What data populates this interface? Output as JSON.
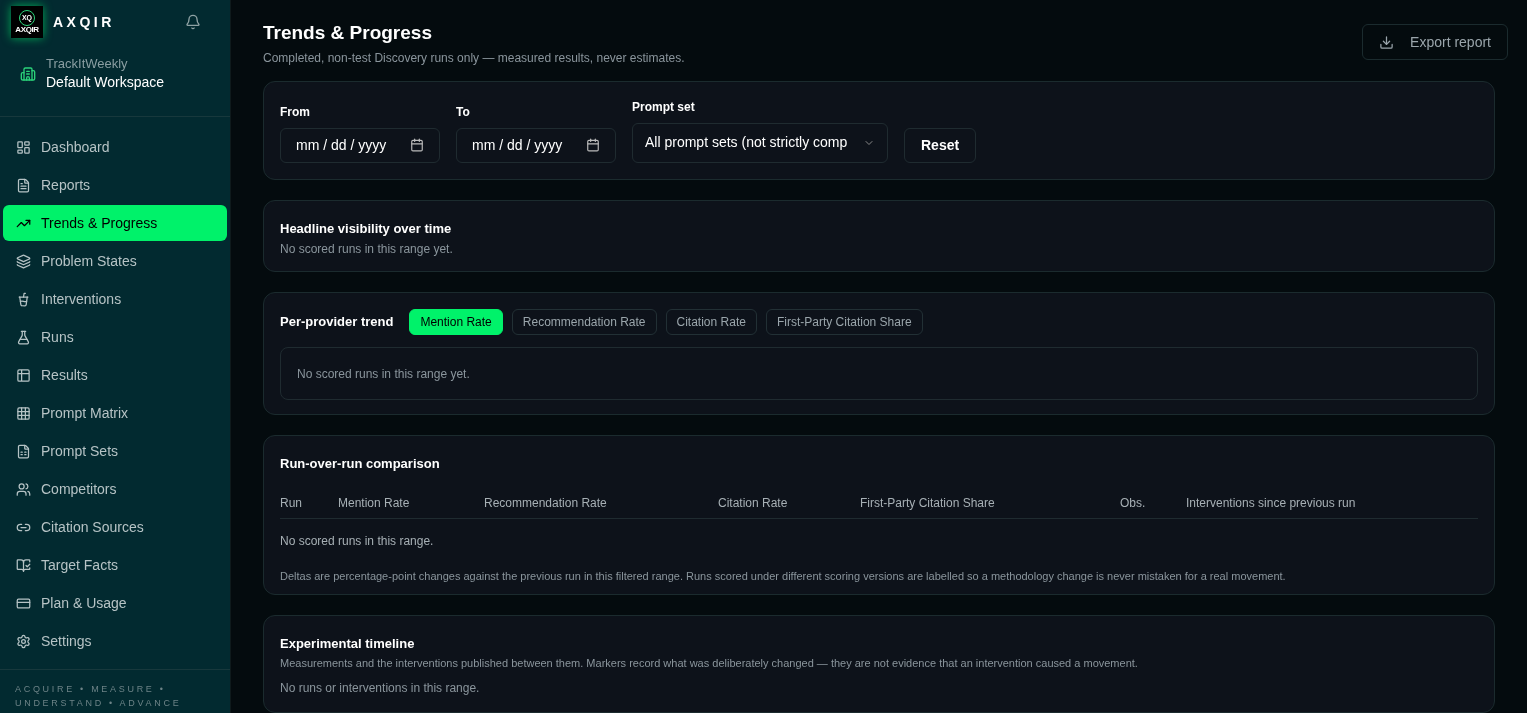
{
  "brand": {
    "logo_text": "AXQIR",
    "logo_mark": "XQ",
    "name": "AXQIR"
  },
  "workspace": {
    "org": "TrackItWeekly",
    "name": "Default Workspace"
  },
  "nav": [
    {
      "label": "Dashboard",
      "selected": false
    },
    {
      "label": "Reports",
      "selected": false
    },
    {
      "label": "Trends & Progress",
      "selected": true
    },
    {
      "label": "Problem States",
      "selected": false
    },
    {
      "label": "Interventions",
      "selected": false
    },
    {
      "label": "Runs",
      "selected": false
    },
    {
      "label": "Results",
      "selected": false
    },
    {
      "label": "Prompt Matrix",
      "selected": false
    },
    {
      "label": "Prompt Sets",
      "selected": false
    },
    {
      "label": "Competitors",
      "selected": false
    },
    {
      "label": "Citation Sources",
      "selected": false
    },
    {
      "label": "Target Facts",
      "selected": false
    },
    {
      "label": "Plan & Usage",
      "selected": false
    },
    {
      "label": "Settings",
      "selected": false
    }
  ],
  "tagline": "ACQUIRE • MEASURE • UNDERSTAND • ADVANCE",
  "page": {
    "title": "Trends & Progress",
    "subtitle": "Completed, non-test Discovery runs only — measured results, never estimates.",
    "export_button": "Export report"
  },
  "filters": {
    "from": {
      "label": "From",
      "placeholder": "mm / dd / yyyy"
    },
    "to": {
      "label": "To",
      "placeholder": "mm / dd / yyyy"
    },
    "prompt_set": {
      "label": "Prompt set",
      "value": "All prompt sets (not strictly comp"
    },
    "reset_button": "Reset"
  },
  "headline": {
    "title": "Headline visibility over time",
    "empty": "No scored runs in this range yet."
  },
  "per_provider": {
    "title": "Per-provider trend",
    "tabs": [
      {
        "label": "Mention Rate",
        "selected": true
      },
      {
        "label": "Recommendation Rate",
        "selected": false
      },
      {
        "label": "Citation Rate",
        "selected": false
      },
      {
        "label": "First-Party Citation Share",
        "selected": false
      }
    ],
    "empty": "No scored runs in this range yet."
  },
  "comparison": {
    "title": "Run-over-run comparison",
    "columns": [
      "Run",
      "Mention Rate",
      "Recommendation Rate",
      "Citation Rate",
      "First-Party Citation Share",
      "Obs.",
      "Interventions since previous run"
    ],
    "empty": "No scored runs in this range.",
    "note": "Deltas are percentage-point changes against the previous run in this filtered range. Runs scored under different scoring versions are labelled so a methodology change is never mistaken for a real movement."
  },
  "timeline": {
    "title": "Experimental timeline",
    "description": "Measurements and the interventions published between them. Markers record what was deliberately changed — they are not evidence that an intervention caused a movement.",
    "empty": "No runs or interventions in this range."
  }
}
